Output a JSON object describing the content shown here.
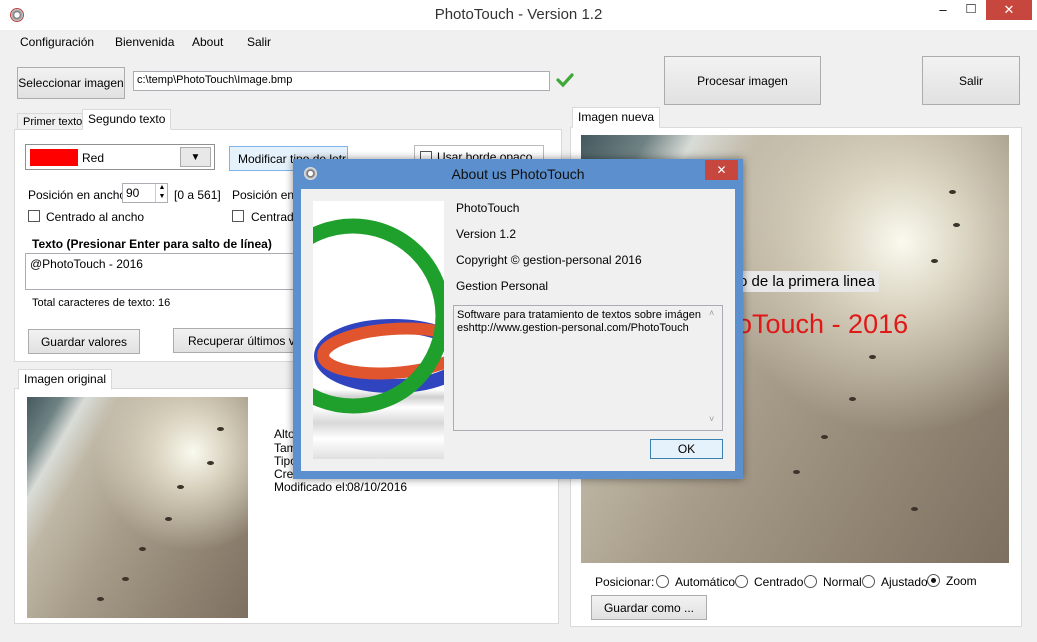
{
  "window": {
    "title": "PhotoTouch - Version 1.2",
    "minimize": "–",
    "maximize": "□",
    "close": "✕"
  },
  "menu": [
    "Configuración",
    "Bienvenida",
    "About",
    "Salir"
  ],
  "toolbar": {
    "select_image_label": "Seleccionar imagen",
    "image_path": "c:\\temp\\PhotoTouch\\Image.bmp",
    "process_label": "Procesar imagen",
    "exit_label": "Salir"
  },
  "text_tabs": {
    "tab1": "Primer texto",
    "tab2": "Segundo texto"
  },
  "text_panel": {
    "color_name": "Red",
    "color_hex": "#ff0000",
    "font_button": "Modificar tipo de letra",
    "opaque_border": "Usar borde opaco",
    "pos_width_label": "Posición en ancho:",
    "pos_width_value": "90",
    "pos_width_range": "[0 a 561]",
    "pos_height_label": "Posición en alto",
    "center_width": "Centrado al ancho",
    "center_height": "Centrado",
    "text_header": "Texto (Presionar Enter para salto de línea)",
    "text_value": "@PhotoTouch - 2016",
    "total_chars": "Total caracteres de texto: 16",
    "save_values": "Guardar valores",
    "recover_values": "Recuperar últimos valores"
  },
  "original_tab": {
    "label": "Imagen original",
    "info": [
      "Alto",
      "Tam",
      "Tipo",
      "Crea"
    ],
    "modified_label": "Modificado el:",
    "modified_value": "08/10/2016"
  },
  "new_image": {
    "tab_label": "Imagen nueva",
    "overlay_line1": "o de la primera linea",
    "overlay_line2": "oTouch - 2016",
    "position_label": "Posicionar:",
    "options": [
      "Automático",
      "Centrado",
      "Normal",
      "Ajustado",
      "Zoom"
    ],
    "selected": "Zoom",
    "save_as": "Guardar como ..."
  },
  "about": {
    "title": "About us PhotoTouch",
    "product": "PhotoTouch",
    "version": "Version 1.2",
    "copyright": "Copyright © gestion-personal 2016",
    "company": "Gestion Personal",
    "description": "Software para tratamiento de textos sobre imágeneshttp://www.gestion-personal.com/PhotoTouch",
    "ok": "OK",
    "close": "✕"
  },
  "colors": {
    "accent": "#5b8fcd",
    "close_red": "#c7463d",
    "check_green": "#3ea83a"
  }
}
